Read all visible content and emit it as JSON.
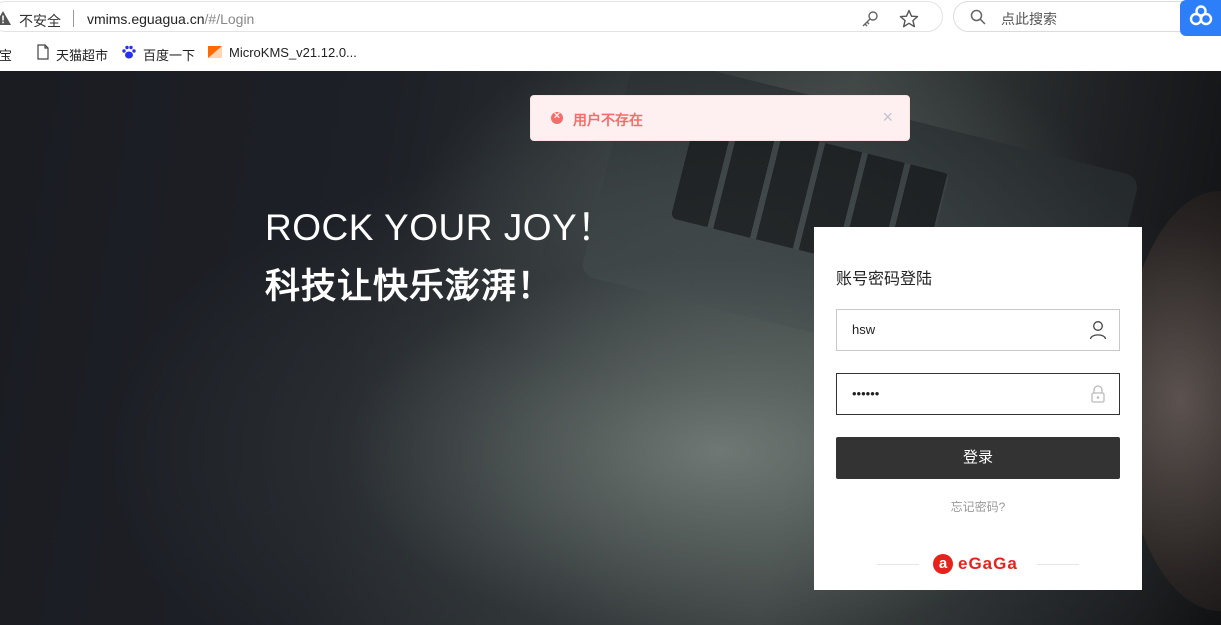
{
  "browser": {
    "security_label": "不安全",
    "url_host": "vmims.eguagua.cn",
    "url_path": "/#/Login",
    "search_placeholder": "点此搜索",
    "bookmarks": [
      {
        "label": "淘宝",
        "icon": "taobao-icon"
      },
      {
        "label": "天猫超市",
        "icon": "page-icon"
      },
      {
        "label": "百度一下",
        "icon": "baidu-icon"
      },
      {
        "label": "MicroKMS_v21.12.0...",
        "icon": "microkms-icon"
      }
    ]
  },
  "toast": {
    "message": "用户不存在",
    "type": "error",
    "close_symbol": "×"
  },
  "hero": {
    "slogan_en": "ROCK YOUR JOY！",
    "slogan_cn": "科技让快乐澎湃！"
  },
  "login": {
    "title": "账号密码登陆",
    "username_value": "hsw",
    "password_value": "••••••",
    "submit_label": "登录",
    "forgot_label": "忘记密码?",
    "brand": "eGaGa"
  },
  "colors": {
    "error": "#f56c6c",
    "error_bg": "#fef0f0",
    "button_bg": "#333333",
    "brand_red": "#e5231c",
    "extension_blue": "#2d7ff9"
  }
}
